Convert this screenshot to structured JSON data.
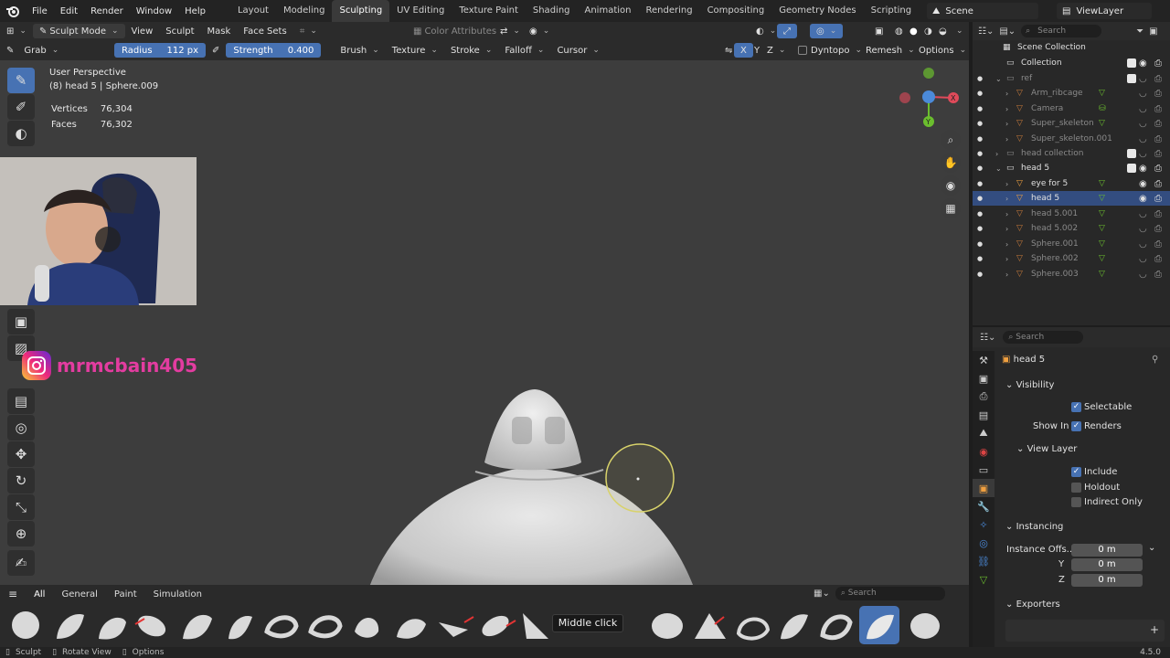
{
  "menu": {
    "items": [
      "File",
      "Edit",
      "Render",
      "Window",
      "Help"
    ],
    "workspaces": [
      "Layout",
      "Modeling",
      "Sculpting",
      "UV Editing",
      "Texture Paint",
      "Shading",
      "Animation",
      "Rendering",
      "Compositing",
      "Geometry Nodes",
      "Scripting"
    ],
    "active_workspace": "Sculpting",
    "scene": "Scene",
    "view_layer": "ViewLayer"
  },
  "viewport_header": {
    "mode": "Sculpt Mode",
    "menus": [
      "View",
      "Sculpt",
      "Mask",
      "Face Sets"
    ],
    "color_attributes": "Color Attributes"
  },
  "tool_header": {
    "tool": "Grab",
    "radius_label": "Radius",
    "radius_value": "112 px",
    "strength_label": "Strength",
    "strength_value": "0.400",
    "menus": [
      "Brush",
      "Texture",
      "Stroke",
      "Falloff",
      "Cursor"
    ],
    "axes": [
      "X",
      "Y",
      "Z"
    ],
    "dyntopo": "Dyntopo",
    "remesh": "Remesh",
    "options": "Options"
  },
  "viewport": {
    "view_name": "User Perspective",
    "object_info": "(8) head 5 | Sphere.009",
    "stats": [
      {
        "label": "Vertices",
        "value": "76,304"
      },
      {
        "label": "Faces",
        "value": "76,302"
      }
    ]
  },
  "overlay": {
    "instagram_handle": "mrmcbain405"
  },
  "shelf": {
    "tabs": [
      "All",
      "General",
      "Paint",
      "Simulation"
    ],
    "active_tab": "All",
    "search_placeholder": "Search",
    "tooltip": "Middle click"
  },
  "statusbar": {
    "items": [
      "Sculpt",
      "Rotate View",
      "Options"
    ],
    "version": "4.5.0"
  },
  "outliner": {
    "search_placeholder": "Search",
    "rows": [
      {
        "name": "Scene Collection",
        "dim": false
      },
      {
        "name": "Collection",
        "dim": false
      },
      {
        "name": "ref",
        "dim": true
      },
      {
        "name": "Arm_ribcage",
        "dim": true
      },
      {
        "name": "Camera",
        "dim": true
      },
      {
        "name": "Super_skeleton",
        "dim": true
      },
      {
        "name": "Super_skeleton.001",
        "dim": true
      },
      {
        "name": "head collection",
        "dim": true
      },
      {
        "name": "head 5",
        "dim": false
      },
      {
        "name": "eye for 5",
        "dim": false
      },
      {
        "name": "head 5",
        "dim": false
      },
      {
        "name": "head 5.001",
        "dim": true
      },
      {
        "name": "head 5.002",
        "dim": true
      },
      {
        "name": "Sphere.001",
        "dim": true
      },
      {
        "name": "Sphere.002",
        "dim": true
      },
      {
        "name": "Sphere.003",
        "dim": true
      }
    ]
  },
  "properties": {
    "search_placeholder": "Search",
    "object_name": "head 5",
    "visibility_title": "Visibility",
    "selectable": "Selectable",
    "show_in": "Show In",
    "renders": "Renders",
    "view_layer_title": "View Layer",
    "include": "Include",
    "holdout": "Holdout",
    "indirect_only": "Indirect Only",
    "instancing_title": "Instancing",
    "instance_offset_label": "Instance Offs...",
    "offset_x": "0 m",
    "y_label": "Y",
    "offset_y": "0 m",
    "z_label": "Z",
    "offset_z": "0 m",
    "exporters_title": "Exporters"
  },
  "colors": {
    "accent": "#4772b3",
    "brush_cursor": "#d8d26a",
    "instagram": "#e33ca0"
  }
}
